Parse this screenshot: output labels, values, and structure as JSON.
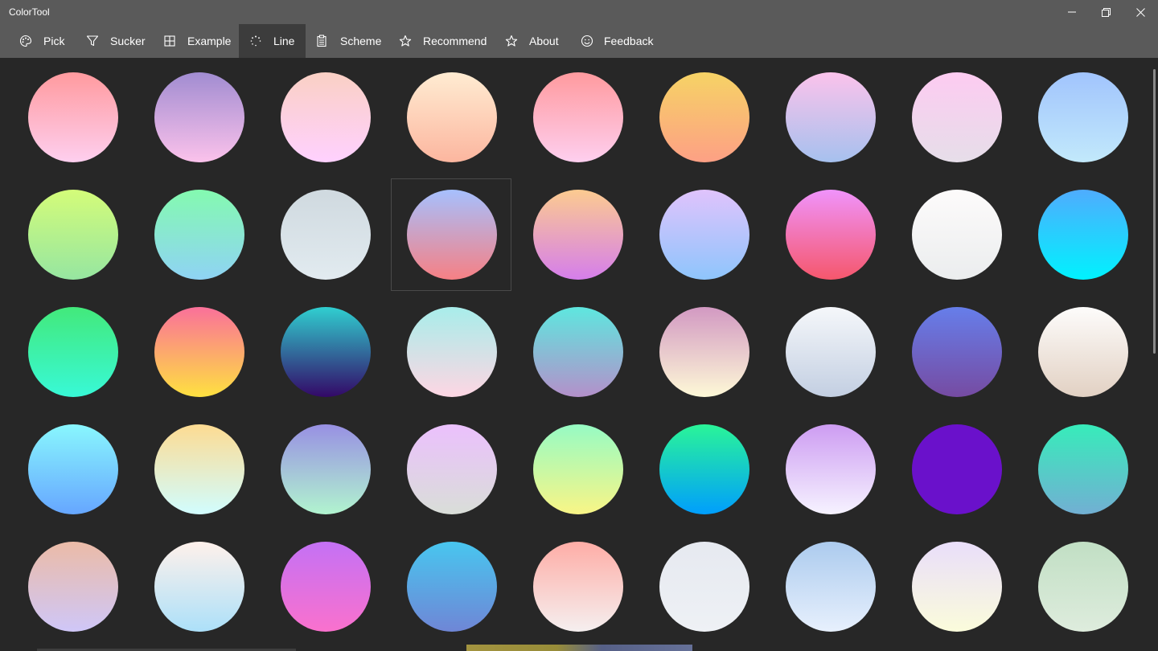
{
  "app": {
    "title": "ColorTool"
  },
  "nav": {
    "items": [
      {
        "label": "Pick",
        "icon": "palette-icon"
      },
      {
        "label": "Sucker",
        "icon": "filter-icon"
      },
      {
        "label": "Example",
        "icon": "grid-icon"
      },
      {
        "label": "Line",
        "icon": "loading-dots-icon",
        "active": true
      },
      {
        "label": "Scheme",
        "icon": "clipboard-icon"
      },
      {
        "label": "Recommend",
        "icon": "star-icon"
      },
      {
        "label": "About",
        "icon": "star-outline-icon"
      },
      {
        "label": "Feedback",
        "icon": "smiley-icon"
      }
    ]
  },
  "gradients": [
    [
      "#ff9a9e",
      "#fecfef"
    ],
    [
      "#a18cd1",
      "#fbc2eb"
    ],
    [
      "#fad0c4",
      "#ffd1ff"
    ],
    [
      "#ffecd2",
      "#fcb69f"
    ],
    [
      "#ff9a9e",
      "#fecfef"
    ],
    [
      "#f6d365",
      "#fda085"
    ],
    [
      "#fbc2eb",
      "#a6c1ee"
    ],
    [
      "#fdcbf1",
      "#e6dee9"
    ],
    [
      "#a1c4fd",
      "#c2e9fb"
    ],
    [
      "#d4fc79",
      "#96e6a1"
    ],
    [
      "#84fab0",
      "#8fd3f4"
    ],
    [
      "#cfd9df",
      "#e2ebf0"
    ],
    [
      "#a6c0fe",
      "#f68084"
    ],
    [
      "#fccb90",
      "#d57eeb"
    ],
    [
      "#e0c3fc",
      "#8ec5fc"
    ],
    [
      "#f093fb",
      "#f5576c"
    ],
    [
      "#fdfbfb",
      "#ebedee"
    ],
    [
      "#4facfe",
      "#00f2fe"
    ],
    [
      "#43e97b",
      "#38f9d7"
    ],
    [
      "#fa709a",
      "#fee140"
    ],
    [
      "#30cfd0",
      "#330867"
    ],
    [
      "#a8edea",
      "#fed6e3"
    ],
    [
      "#5ee7df",
      "#b490ca"
    ],
    [
      "#d299c2",
      "#fef9d7"
    ],
    [
      "#f5f7fa",
      "#c3cfe2"
    ],
    [
      "#667eea",
      "#764ba2"
    ],
    [
      "#fdfcfb",
      "#e2d1c3"
    ],
    [
      "#89f7fe",
      "#66a6ff"
    ],
    [
      "#fddb92",
      "#d1fdff"
    ],
    [
      "#9890e3",
      "#b1f4cf"
    ],
    [
      "#ebc0fd",
      "#d9ded8"
    ],
    [
      "#96fbc4",
      "#f9f586"
    ],
    [
      "#2af598",
      "#009efd"
    ],
    [
      "#cd9cf2",
      "#f6f3ff"
    ],
    [
      "#6a11cb",
      "#6a11cb"
    ],
    [
      "#37ecba",
      "#72afd3"
    ],
    [
      "#ebbba7",
      "#cfc7f8"
    ],
    [
      "#fff1eb",
      "#ace0f9"
    ],
    [
      "#c471f5",
      "#fa71cd"
    ],
    [
      "#48c6ef",
      "#6f86d6"
    ],
    [
      "#feada6",
      "#f5efef"
    ],
    [
      "#e6e9f0",
      "#eef1f5"
    ],
    [
      "#accbee",
      "#e7f0fd"
    ],
    [
      "#e9defa",
      "#fbfcdb"
    ],
    [
      "#c1dfc4",
      "#deecdd"
    ]
  ]
}
